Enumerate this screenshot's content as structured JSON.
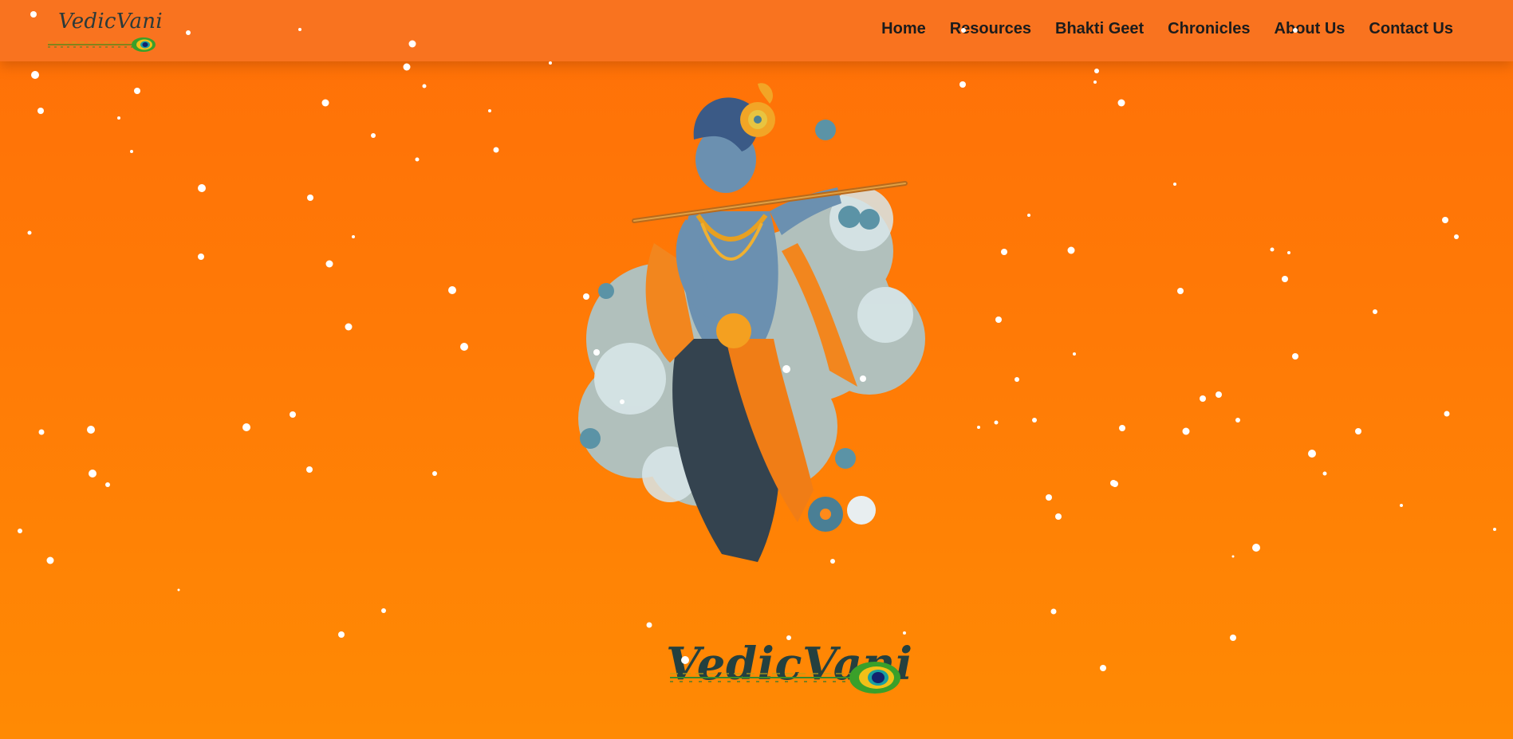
{
  "brand": {
    "name": "VedicVani"
  },
  "nav": {
    "items": [
      {
        "label": "Home"
      },
      {
        "label": "Resources"
      },
      {
        "label": "Bhakti Geet"
      },
      {
        "label": "Chronicles"
      },
      {
        "label": "About Us"
      },
      {
        "label": "Contact Us"
      }
    ]
  },
  "hero": {
    "image_icon": "krishna-flute-illustration",
    "footer_logo": "VedicVani"
  },
  "colors": {
    "navbar": "#f9731f",
    "background_top": "#ff7008",
    "background_bottom": "#ff8a04",
    "text_dark": "#1c1c1c",
    "logo_text": "#24403f"
  }
}
